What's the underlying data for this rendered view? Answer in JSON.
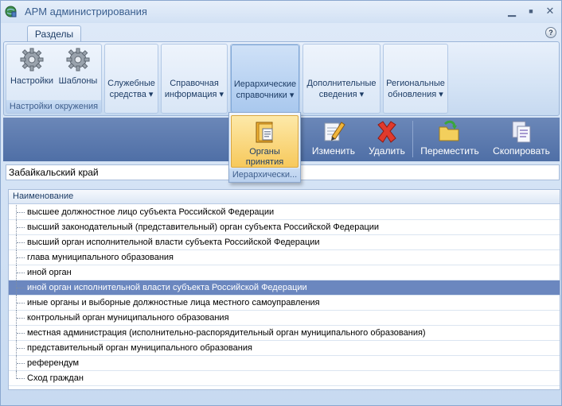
{
  "window": {
    "title": "АРМ администрирования",
    "minimize_glyph": "▁",
    "maximize_glyph": "■",
    "close_glyph": "✕"
  },
  "ribbon": {
    "tab_label": "Разделы",
    "help_glyph": "?",
    "groups": {
      "env": {
        "settings_label": "Настройки",
        "templates_label": "Шаблоны",
        "caption": "Настройки окружения"
      },
      "service": {
        "label": "Служебные средства ▾"
      },
      "reference": {
        "label": "Справочная информация ▾"
      },
      "hierarchical": {
        "label": "Иерархические справочники ▾"
      },
      "additional": {
        "label": "Дополнительные сведения ▾"
      },
      "regional": {
        "label": "Региональные обновления ▾"
      }
    }
  },
  "popup": {
    "item_label": "Органы принятия",
    "caption": "Иерархически..."
  },
  "toolbar": {
    "edit_label": "Изменить",
    "delete_label": "Удалить",
    "move_label": "Переместить",
    "copy_label": "Скопировать"
  },
  "region_field": {
    "value": "Забайкальский край"
  },
  "tree": {
    "header": "Наименование",
    "rows": [
      "высшее должностное лицо субъекта Российской Федерации",
      "высший законодательный (представительный) орган субъекта Российской Федерации",
      "высший орган исполнительной власти субъекта Российской Федерации",
      "глава муниципального образования",
      "иной орган",
      "иной орган исполнительной власти субъекта Российской Федерации",
      "иные органы и выборные должностные лица местного самоуправления",
      "контрольный орган муниципального образования",
      "местная администрация (исполнительно-распорядительный орган муниципального образования)",
      "представительный орган муниципального образования",
      "референдум",
      "Сход граждан"
    ],
    "selected_index": 5
  },
  "colors": {
    "selection": "#6b87bf",
    "toolbar": "#5a78ad",
    "ribbon_active": "#a9c8ee"
  }
}
